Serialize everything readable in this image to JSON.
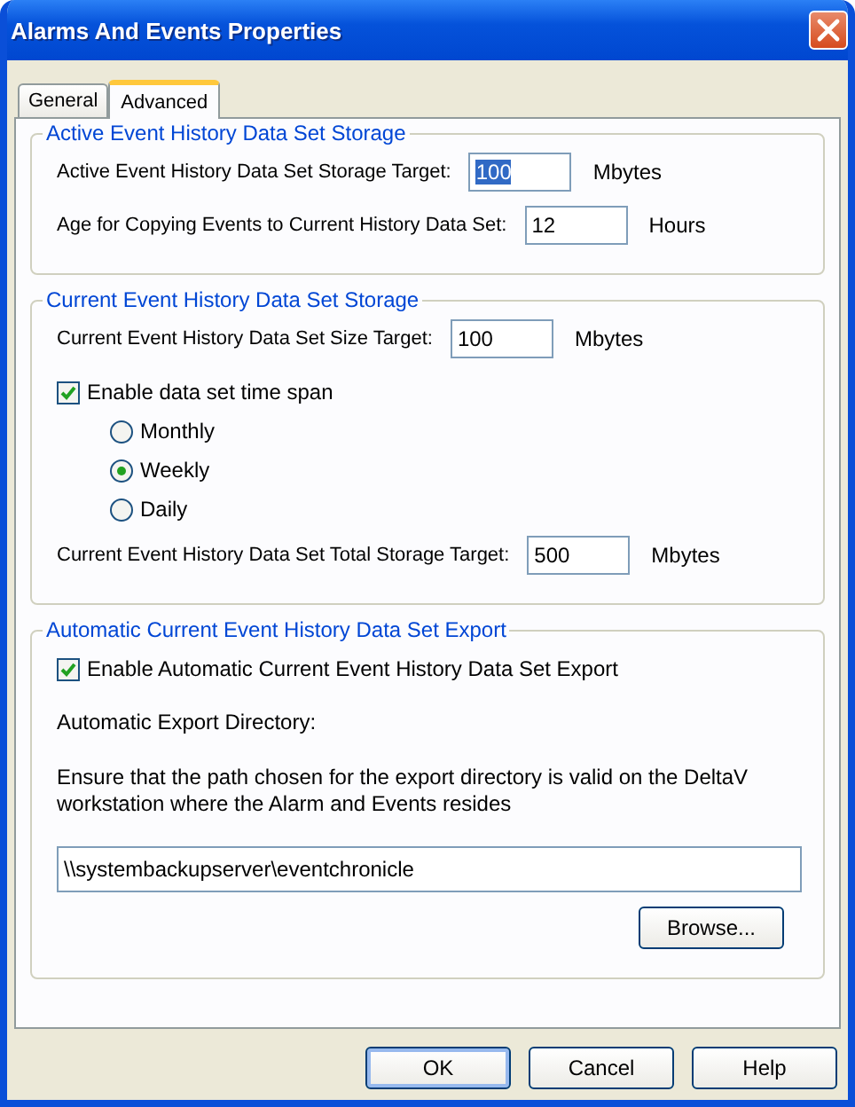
{
  "window": {
    "title": "Alarms And Events Properties"
  },
  "tabs": [
    {
      "label": "General",
      "selected": false
    },
    {
      "label": "Advanced",
      "selected": true
    }
  ],
  "groups": [
    {
      "title": "Active Event History Data Set Storage",
      "rows": [
        {
          "kind": "field",
          "label": "Active Event History Data Set Storage Target:",
          "value": "100",
          "unit": "Mbytes",
          "highlighted": true
        },
        {
          "kind": "field",
          "label": "Age for Copying Events to Current History Data Set:",
          "value": "12",
          "unit": "Hours",
          "highlighted": false
        }
      ]
    },
    {
      "title": "Current Event History Data Set Storage",
      "rows": [
        {
          "kind": "field",
          "label": "Current Event History Data Set Size Target:",
          "value": "100",
          "unit": "Mbytes",
          "highlighted": false
        },
        {
          "kind": "checkbox",
          "label": "Enable data set time span",
          "checked": true
        },
        {
          "kind": "radio",
          "label": "Monthly",
          "selected": false
        },
        {
          "kind": "radio",
          "label": "Weekly",
          "selected": true
        },
        {
          "kind": "radio",
          "label": "Daily",
          "selected": false
        },
        {
          "kind": "field",
          "label": "Current Event History Data Set Total Storage Target:",
          "value": "500",
          "unit": "Mbytes",
          "highlighted": false
        }
      ]
    },
    {
      "title": "Automatic Current Event History Data Set Export",
      "rows": [
        {
          "kind": "checkbox",
          "label": "Enable Automatic Current Event History Data Set Export",
          "checked": true
        },
        {
          "kind": "text",
          "label": "Automatic Export Directory:"
        },
        {
          "kind": "text",
          "label": "Ensure that the path chosen for the export directory is valid on the DeltaV workstation where the Alarm and Events resides"
        },
        {
          "kind": "path",
          "value": "\\\\systembackupserver\\eventchronicle"
        },
        {
          "kind": "button",
          "label": "Browse..."
        }
      ]
    }
  ],
  "buttons": [
    {
      "label": "OK",
      "default": true
    },
    {
      "label": "Cancel",
      "default": false
    },
    {
      "label": "Help",
      "default": false
    }
  ]
}
